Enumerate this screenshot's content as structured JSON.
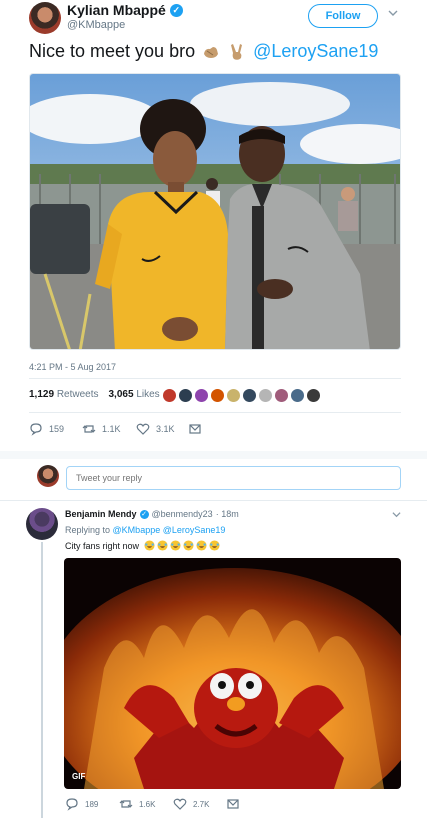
{
  "tweet": {
    "author_name": "Kylian Mbappé",
    "author_handle": "@KMbappe",
    "follow_label": "Follow",
    "text": "Nice to meet you bro",
    "mention": "@LeroySane19",
    "timestamp": "4:21 PM - 5 Aug 2017",
    "retweets_count": "1,129",
    "retweets_label": "Retweets",
    "likes_count": "3,065",
    "likes_label": "Likes",
    "actions": {
      "reply_count": "159",
      "retweet_count": "1.1K",
      "like_count": "3.1K"
    }
  },
  "reply_box": {
    "placeholder": "Tweet your reply"
  },
  "reply": {
    "author_name": "Benjamin Mendy",
    "author_handle": "@benmendy23",
    "time": "· 18m",
    "replying_prefix": "Replying to",
    "replying_to_1": "@KMbappe",
    "replying_to_2": "@LeroySane19",
    "text": "City fans right now",
    "gif_label": "GIF",
    "actions": {
      "reply_count": "189",
      "retweet_count": "1.6K",
      "like_count": "2.7K"
    }
  },
  "colors": {
    "accent": "#1da1f2",
    "muted": "#657786",
    "text": "#14171a"
  },
  "icons": [
    "verified-icon",
    "chevron-down-icon",
    "reply-icon",
    "retweet-icon",
    "like-icon",
    "message-icon"
  ]
}
